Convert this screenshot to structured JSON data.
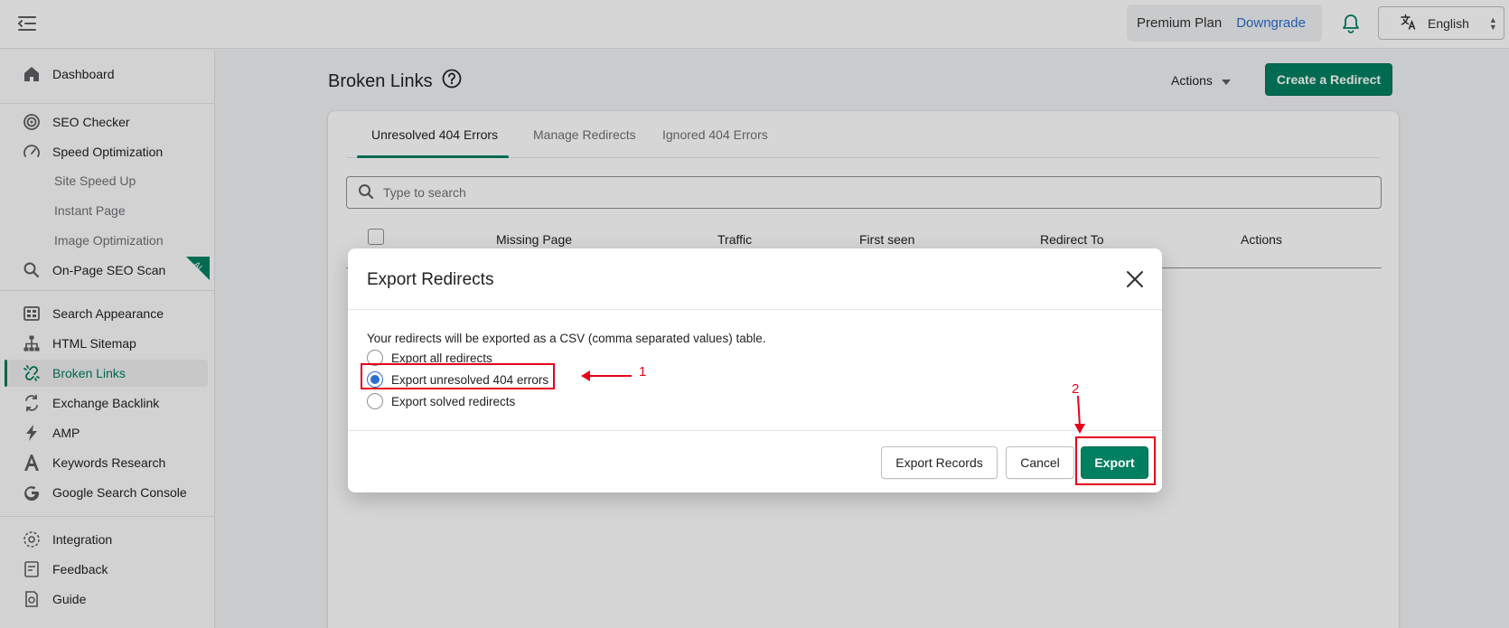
{
  "topbar": {
    "menu_icon": "menu-collapse-icon",
    "plan_name": "Premium Plan",
    "plan_action": "Downgrade",
    "notification_icon": "bell-icon",
    "language": "English",
    "language_icon": "translate-icon"
  },
  "sidebar": {
    "items": [
      {
        "label": "Dashboard",
        "icon": "home-icon"
      },
      {
        "label": "SEO Checker",
        "icon": "gauge-icon"
      },
      {
        "label": "Speed Optimization",
        "icon": "speedometer-icon"
      },
      {
        "label": "Site Speed Up"
      },
      {
        "label": "Instant Page"
      },
      {
        "label": "Image Optimization"
      },
      {
        "label": "On-Page SEO Scan",
        "icon": "search-icon",
        "badge": "AI"
      },
      {
        "label": "Search Appearance",
        "icon": "grid-icon"
      },
      {
        "label": "HTML Sitemap",
        "icon": "sitemap-icon"
      },
      {
        "label": "Broken Links",
        "icon": "broken-link-icon",
        "active": true
      },
      {
        "label": "Exchange Backlink",
        "icon": "exchange-icon"
      },
      {
        "label": "AMP",
        "icon": "bolt-icon"
      },
      {
        "label": "Keywords Research",
        "icon": "letter-a-icon"
      },
      {
        "label": "Google Search Console",
        "icon": "google-icon"
      },
      {
        "label": "Integration",
        "icon": "integration-icon"
      },
      {
        "label": "Feedback",
        "icon": "feedback-icon"
      },
      {
        "label": "Guide",
        "icon": "guide-icon"
      }
    ]
  },
  "page": {
    "title": "Broken Links",
    "help_icon": "help-circle-icon",
    "actions_label": "Actions",
    "create_label": "Create a Redirect",
    "tabs": [
      {
        "label": "Unresolved 404 Errors",
        "active": true
      },
      {
        "label": "Manage Redirects"
      },
      {
        "label": "Ignored 404 Errors"
      }
    ],
    "search_placeholder": "Type to search",
    "columns": [
      "Missing Page",
      "Traffic",
      "First seen",
      "Redirect To",
      "Actions"
    ]
  },
  "modal": {
    "title": "Export Redirects",
    "description": "Your redirects will be exported as a CSV (comma separated values) table.",
    "options": [
      {
        "label": "Export all redirects",
        "checked": false
      },
      {
        "label": "Export unresolved 404 errors",
        "checked": true
      },
      {
        "label": "Export solved redirects",
        "checked": false
      }
    ],
    "buttons": {
      "export_records": "Export Records",
      "cancel": "Cancel",
      "export": "Export"
    }
  },
  "annotations": {
    "step1": "1",
    "step2": "2",
    "color": "#e5001c"
  },
  "colors": {
    "accent": "#008060",
    "radio_selected": "#2c6ecb",
    "link": "#2c6ecb"
  }
}
